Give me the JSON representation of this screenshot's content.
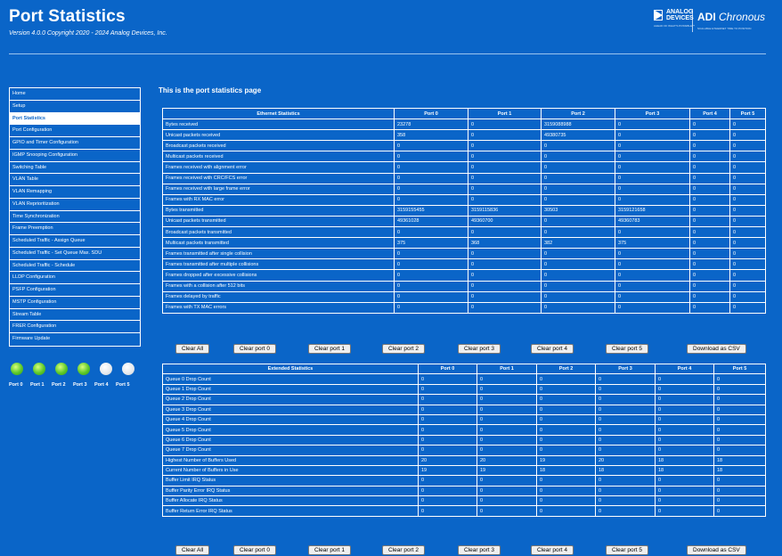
{
  "header": {
    "title": "Port Statistics",
    "version": "Version 4.0.0 Copyright 2020 - 2024 Analog Devices, Inc.",
    "logo_analog_line1": "ANALOG",
    "logo_analog_line2": "DEVICES",
    "logo_analog_tagline": "AHEAD OF WHAT'S POSSIBLE™",
    "logo_adi": "ADI",
    "logo_chronous": "Chronous",
    "logo_chronous_tagline": "SCALABLE ETHERNET TIME TO POSITION"
  },
  "sidebar": {
    "items": [
      {
        "label": "Home"
      },
      {
        "label": "Setup"
      },
      {
        "label": "Port Statistics",
        "active": true
      },
      {
        "label": "Port Configuration"
      },
      {
        "label": "GPIO and Timer Configuration"
      },
      {
        "label": "IGMP Snooping Configuration"
      },
      {
        "label": "Switching Table"
      },
      {
        "label": "VLAN Table"
      },
      {
        "label": "VLAN Remapping"
      },
      {
        "label": "VLAN Reprioritization"
      },
      {
        "label": "Time Synchronization"
      },
      {
        "label": "Frame Preemption"
      },
      {
        "label": "Scheduled Traffic - Assign Queue"
      },
      {
        "label": "Scheduled Traffic - Set Queue Max. SDU"
      },
      {
        "label": "Scheduled Traffic - Schedule"
      },
      {
        "label": "LLDP Configuration"
      },
      {
        "label": "PSFP Configuration"
      },
      {
        "label": "MSTP Configuration"
      },
      {
        "label": "Stream Table"
      },
      {
        "label": "FRER Configuration"
      },
      {
        "label": "Firmware Update"
      }
    ]
  },
  "port_leds": [
    {
      "label": "Port 0",
      "state": "up",
      "color": "#5cc82a"
    },
    {
      "label": "Port 1",
      "state": "up",
      "color": "#5cc82a"
    },
    {
      "label": "Port 2",
      "state": "up",
      "color": "#5cc82a"
    },
    {
      "label": "Port 3",
      "state": "up",
      "color": "#5cc82a"
    },
    {
      "label": "Port 4",
      "state": "down",
      "color": "#e4e8ec"
    },
    {
      "label": "Port 5",
      "state": "down",
      "color": "#e4e8ec"
    }
  ],
  "main": {
    "heading": "This is the port statistics page",
    "ethernet": {
      "columns": [
        "Ethernet Statistics",
        "Port 0",
        "Port 1",
        "Port 2",
        "Port 3",
        "Port 4",
        "Port 5"
      ],
      "rows": [
        [
          "Bytes received",
          "23278",
          "0",
          "3159088988",
          "0",
          "0",
          "0"
        ],
        [
          "Unicast packets received",
          "358",
          "0",
          "49380735",
          "0",
          "0",
          "0"
        ],
        [
          "Broadcast packets received",
          "0",
          "0",
          "0",
          "0",
          "0",
          "0"
        ],
        [
          "Multicast packets received",
          "0",
          "0",
          "0",
          "0",
          "0",
          "0"
        ],
        [
          "Frames received with alignment error",
          "0",
          "0",
          "0",
          "0",
          "0",
          "0"
        ],
        [
          "Frames received with CRC/FCS error",
          "0",
          "0",
          "0",
          "0",
          "0",
          "0"
        ],
        [
          "Frames received with large frame error",
          "0",
          "0",
          "0",
          "0",
          "0",
          "0"
        ],
        [
          "Frames with RX MAC error",
          "0",
          "0",
          "0",
          "0",
          "0",
          "0"
        ],
        [
          "Bytes transmitted",
          "3159155455",
          "3159115836",
          "30503",
          "3159121658",
          "0",
          "0"
        ],
        [
          "Unicast packets transmitted",
          "49361028",
          "49360700",
          "0",
          "49360783",
          "0",
          "0"
        ],
        [
          "Broadcast packets transmitted",
          "0",
          "0",
          "0",
          "0",
          "0",
          "0"
        ],
        [
          "Multicast packets transmitted",
          "375",
          "368",
          "382",
          "375",
          "0",
          "0"
        ],
        [
          "Frames transmitted after single collision",
          "0",
          "0",
          "0",
          "0",
          "0",
          "0"
        ],
        [
          "Frames transmitted after multiple collisions",
          "0",
          "0",
          "0",
          "0",
          "0",
          "0"
        ],
        [
          "Frames dropped after excessive collisions",
          "0",
          "0",
          "0",
          "0",
          "0",
          "0"
        ],
        [
          "Frames with a collision after 512 bits",
          "0",
          "0",
          "0",
          "0",
          "0",
          "0"
        ],
        [
          "Frames delayed by traffic",
          "0",
          "0",
          "0",
          "0",
          "0",
          "0"
        ],
        [
          "Frames with TX MAC errors",
          "0",
          "0",
          "0",
          "0",
          "0",
          "0"
        ]
      ]
    },
    "extended": {
      "columns": [
        "Extended Statistics",
        "Port 0",
        "Port 1",
        "Port 2",
        "Port 3",
        "Port 4",
        "Port 5"
      ],
      "rows": [
        [
          "Queue 0 Drop Count",
          "0",
          "0",
          "0",
          "0",
          "0",
          "0"
        ],
        [
          "Queue 1 Drop Count",
          "0",
          "0",
          "0",
          "0",
          "0",
          "0"
        ],
        [
          "Queue 2 Drop Count",
          "0",
          "0",
          "0",
          "0",
          "0",
          "0"
        ],
        [
          "Queue 3 Drop Count",
          "0",
          "0",
          "0",
          "0",
          "0",
          "0"
        ],
        [
          "Queue 4 Drop Count",
          "0",
          "0",
          "0",
          "0",
          "0",
          "0"
        ],
        [
          "Queue 5 Drop Count",
          "0",
          "0",
          "0",
          "0",
          "0",
          "0"
        ],
        [
          "Queue 6 Drop Count",
          "0",
          "0",
          "0",
          "0",
          "0",
          "0"
        ],
        [
          "Queue 7 Drop Count",
          "0",
          "0",
          "0",
          "0",
          "0",
          "0"
        ],
        [
          "Highest Number of Buffers Used",
          "20",
          "20",
          "19",
          "20",
          "18",
          "18"
        ],
        [
          "Current Number of Buffers in Use",
          "19",
          "19",
          "18",
          "18",
          "18",
          "18"
        ],
        [
          "Buffer Limit IRQ Status",
          "0",
          "0",
          "0",
          "0",
          "0",
          "0"
        ],
        [
          "Buffer Parity Error IRQ Status",
          "0",
          "0",
          "0",
          "0",
          "0",
          "0"
        ],
        [
          "Buffer Allocate IRQ Status",
          "0",
          "0",
          "0",
          "0",
          "0",
          "0"
        ],
        [
          "Buffer Return Error IRQ Status",
          "0",
          "0",
          "0",
          "0",
          "0",
          "0"
        ]
      ]
    },
    "buttons": [
      "Clear All",
      "Clear port 0",
      "Clear port 1",
      "Clear port 2",
      "Clear port 3",
      "Clear port 4",
      "Clear port 5",
      "Download as CSV"
    ]
  }
}
